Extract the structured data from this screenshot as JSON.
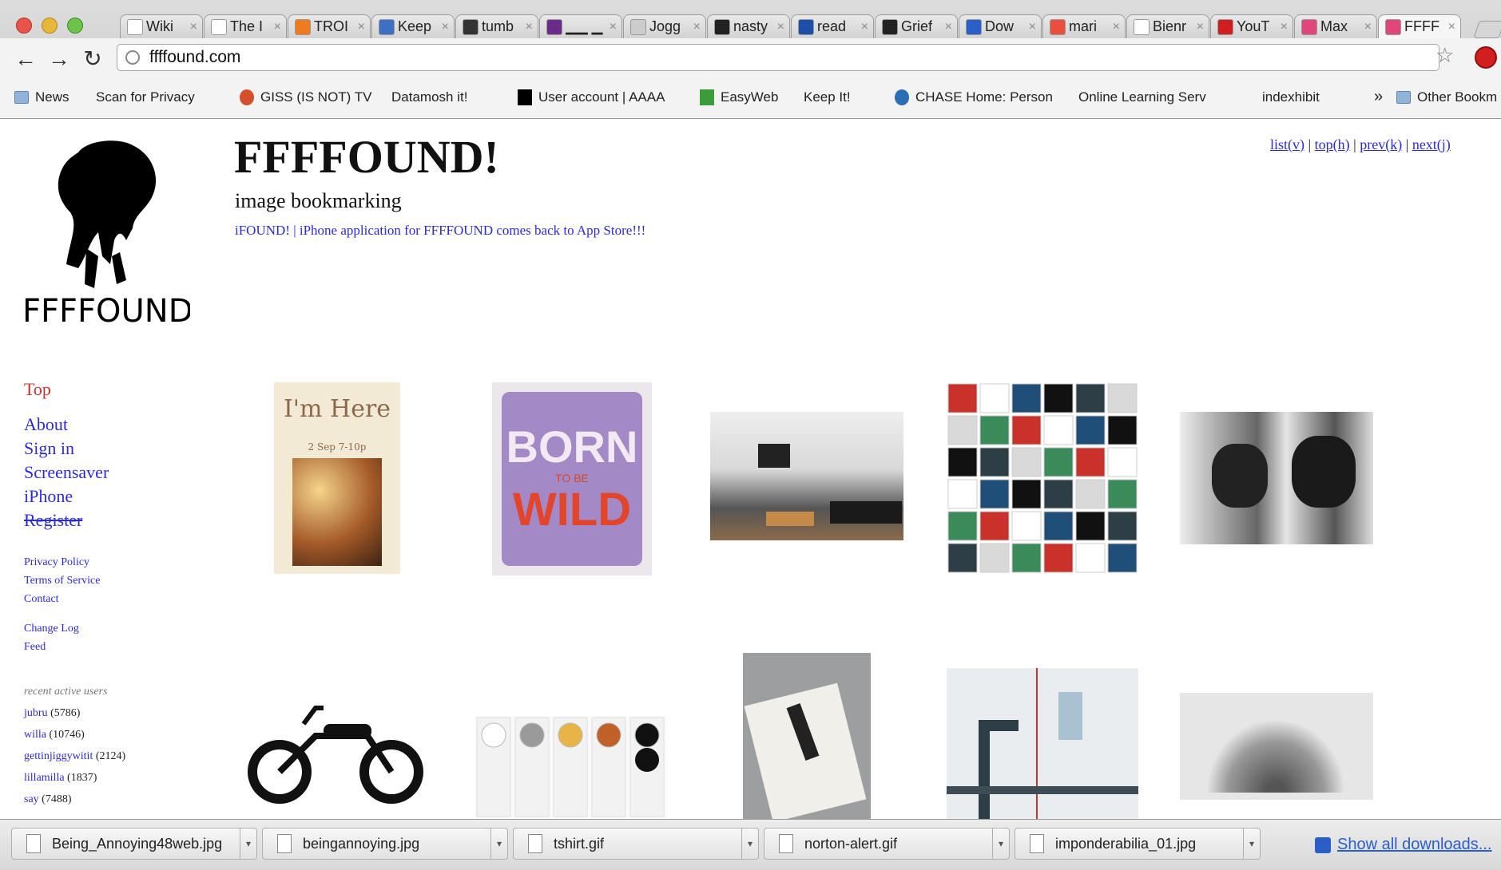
{
  "tabs": [
    {
      "title": "Wiki",
      "fav": "#ffffff"
    },
    {
      "title": "The I",
      "fav": "#ffffff"
    },
    {
      "title": "TROI",
      "fav": "#f07a1e"
    },
    {
      "title": "Keep",
      "fav": "#3d6fc2"
    },
    {
      "title": "tumb",
      "fav": "#333333"
    },
    {
      "title": "▁▁ ▁",
      "fav": "#6b2b8a"
    },
    {
      "title": "Jogg",
      "fav": "#cccccc"
    },
    {
      "title": "nasty",
      "fav": "#222222"
    },
    {
      "title": "read",
      "fav": "#1d4fa8"
    },
    {
      "title": "Grief",
      "fav": "#222222"
    },
    {
      "title": "Dow",
      "fav": "#2b5fc7"
    },
    {
      "title": "mari",
      "fav": "#e94f3c"
    },
    {
      "title": "Bienr",
      "fav": "#ffffff"
    },
    {
      "title": "YouT",
      "fav": "#d11f1f"
    },
    {
      "title": "Max",
      "fav": "#e0457b"
    },
    {
      "title": "FFFF",
      "fav": "#e0457b"
    }
  ],
  "toolbar": {
    "url": "ffffound.com",
    "back_icon": "back-arrow-icon",
    "forward_icon": "forward-arrow-icon",
    "reload_icon": "reload-icon"
  },
  "bookmarks": {
    "items": [
      {
        "label": "News",
        "icon": "folder"
      },
      {
        "label": "Scan for Privacy",
        "icon": "page"
      },
      {
        "label": "GISS (IS NOT) TV",
        "icon": "round"
      },
      {
        "label": "Datamosh it!",
        "icon": "page"
      },
      {
        "label": "User account | AAAA",
        "icon": "black"
      },
      {
        "label": "EasyWeb",
        "icon": "green"
      },
      {
        "label": "Keep It!",
        "icon": "page"
      },
      {
        "label": "CHASE Home: Person",
        "icon": "blue"
      },
      {
        "label": "Online Learning Serv",
        "icon": "page"
      },
      {
        "label": "indexhibit",
        "icon": "page"
      }
    ],
    "overflow": "»",
    "other": "Other Bookm"
  },
  "site": {
    "logo_text": "FFFFOUND!",
    "title": "FFFFOUND!",
    "subtitle": "image bookmarking",
    "promo": "iFOUND! | iPhone application for FFFFOUND comes back to App Store!!!",
    "topnav": {
      "list": "list(v)",
      "top": "top(h)",
      "prev": "prev(k)",
      "next": "next(j)",
      "sep": "|"
    }
  },
  "sidebar": {
    "top": "Top",
    "links": [
      "About",
      "Sign in",
      "Screensaver",
      "iPhone",
      "Register"
    ],
    "small_links": [
      "Privacy Policy",
      "Terms of Service",
      "Contact"
    ],
    "small_links2": [
      "Change Log",
      "Feed"
    ],
    "recent_heading": "recent active users",
    "users": [
      {
        "name": "jubru",
        "count": "(5786)"
      },
      {
        "name": "willa",
        "count": "(10746)"
      },
      {
        "name": "gettinjiggywitit",
        "count": "(2124)"
      },
      {
        "name": "lillamilla",
        "count": "(1837)"
      },
      {
        "name": "say",
        "count": "(7488)"
      }
    ]
  },
  "thumbnails": {
    "poster_heading": "I'm Here",
    "poster_date": "2 Sep    7-10p",
    "born_text": "BORN",
    "tobe_text": "TO BE",
    "wild_text": "WILD"
  },
  "downloads": {
    "items": [
      "Being_Annoying48web.jpg",
      "beingannoying.jpg",
      "tshirt.gif",
      "norton-alert.gif",
      "imponderabilia_01.jpg"
    ],
    "show_all": "Show all downloads..."
  }
}
